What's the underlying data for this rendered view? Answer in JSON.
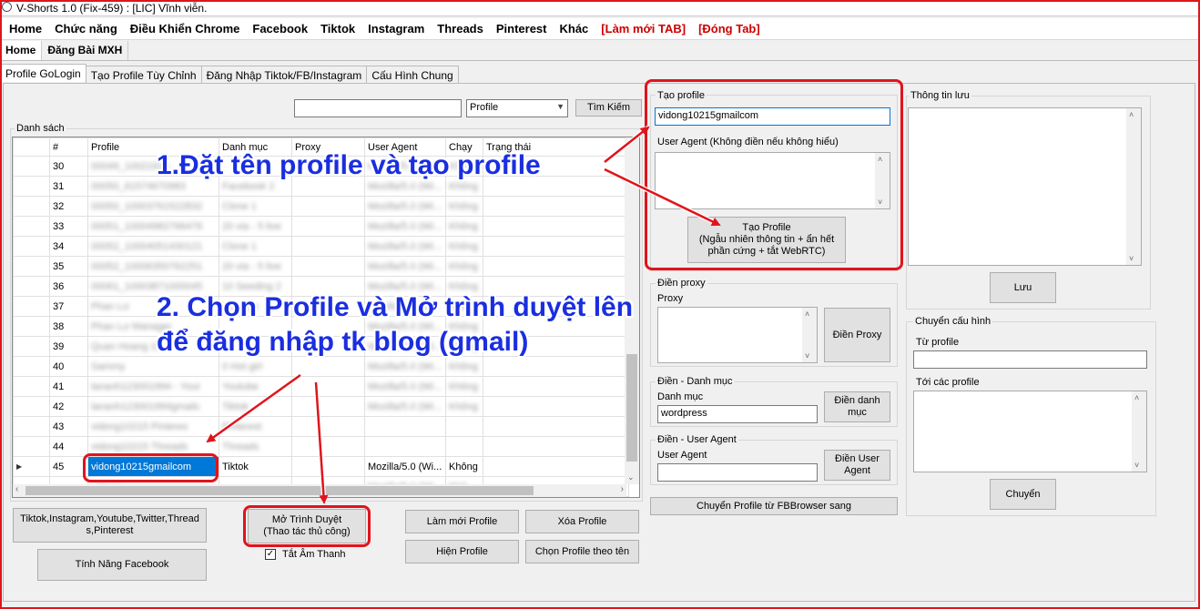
{
  "window": {
    "title": "V-Shorts 1.0 (Fix-459) : [LIC] Vĩnh viễn."
  },
  "menu": [
    {
      "label": "Home",
      "red": false
    },
    {
      "label": "Chức năng",
      "red": false
    },
    {
      "label": "Điều Khiển Chrome",
      "red": false
    },
    {
      "label": "Facebook",
      "red": false
    },
    {
      "label": "Tiktok",
      "red": false
    },
    {
      "label": "Instagram",
      "red": false
    },
    {
      "label": "Threads",
      "red": false
    },
    {
      "label": "Pinterest",
      "red": false
    },
    {
      "label": "Khác",
      "red": false
    },
    {
      "label": "[Làm mới TAB]",
      "red": true
    },
    {
      "label": "[Đóng Tab]",
      "red": true
    }
  ],
  "subtabs": [
    "Home",
    "Đăng Bài MXH"
  ],
  "tabs": [
    "Profile GoLogin",
    "Tạo Profile Tùy Chỉnh",
    "Đăng Nhập Tiktok/FB/Instagram",
    "Cấu Hình Chung"
  ],
  "search": {
    "value": "",
    "select": "Profile",
    "button": "Tìm Kiếm"
  },
  "list": {
    "label": "Danh sách",
    "columns": [
      "#",
      "Profile",
      "Danh mục",
      "Proxy",
      "User Agent",
      "Chạy",
      "Trạng thái"
    ],
    "rows": [
      {
        "n": "30",
        "profile": "00049_10021915",
        "cat": "",
        "ua": "Mozilla/5.0 (Wi...",
        "run": "Không"
      },
      {
        "n": "31",
        "profile": "00050_61574670983",
        "cat": "Facebook 2",
        "ua": "Mozilla/5.0 (Wi...",
        "run": "Không"
      },
      {
        "n": "32",
        "profile": "00050_10003761522832",
        "cat": "Clone 1",
        "ua": "Mozilla/5.0 (Wi...",
        "run": "Không"
      },
      {
        "n": "33",
        "profile": "00051_10004982766476",
        "cat": "20 via - 5 live",
        "ua": "Mozilla/5.0 (Wi...",
        "run": "Không"
      },
      {
        "n": "34",
        "profile": "00052_10004051430121",
        "cat": "Clone 1",
        "ua": "Mozilla/5.0 (Wi...",
        "run": "Không"
      },
      {
        "n": "35",
        "profile": "00052_10006350762251",
        "cat": "20 via - 5 live",
        "ua": "Mozilla/5.0 (Wi...",
        "run": "Không"
      },
      {
        "n": "36",
        "profile": "00061_10003871000045",
        "cat": "10 Seeding 2",
        "ua": "Mozilla/5.0 (Wi...",
        "run": "Không"
      },
      {
        "n": "37",
        "profile": "Phan Lư",
        "cat": "Youtube",
        "ua": "Mozilla/5.0 (Wi...",
        "run": "Không"
      },
      {
        "n": "38",
        "profile": "Phan Lư Manager",
        "cat": "",
        "ua": "Mozilla/5.0 (Wi...",
        "run": "Không"
      },
      {
        "n": "39",
        "profile": "Quan Hoang 10",
        "cat": "",
        "ua": "Mozilla/5.0 (Wi...",
        "run": "Không"
      },
      {
        "n": "40",
        "profile": "Sammy",
        "cat": "0 Hot girl",
        "ua": "Mozilla/5.0 (Wi...",
        "run": "Không"
      },
      {
        "n": "41",
        "profile": "lananh123001994 - Yout",
        "cat": "Youtube",
        "ua": "Mozilla/5.0 (Wi...",
        "run": "Không"
      },
      {
        "n": "42",
        "profile": "lananh123001994gmailc",
        "cat": "Tiktok",
        "ua": "Mozilla/5.0 (Wi...",
        "run": "Không"
      },
      {
        "n": "43",
        "profile": "vidong10215 Pinteres",
        "cat": "Pinterest",
        "ua": "",
        "run": ""
      },
      {
        "n": "44",
        "profile": "vidong10215 Threads",
        "cat": "Threads",
        "ua": "",
        "run": ""
      }
    ],
    "selected": {
      "n": "45",
      "profile": "vidong10215gmailcom",
      "cat": "Tiktok",
      "ua": "Mozilla/5.0 (Wi...",
      "run": "Không"
    },
    "partial": {
      "profile": "vidong...",
      "cat": "...",
      "ua": "Mozilla/5.0 (Wi...",
      "run": "Khô..."
    }
  },
  "buttons": {
    "tiktok": "Tiktok,Instagram,Youtube,Twitter,Threads,Pinterest",
    "facebook": "Tính Năng Facebook",
    "open_browser_1": "Mở Trình Duyệt",
    "open_browser_2": "(Thao tác thủ công)",
    "mute": "Tắt Âm Thanh",
    "refresh_profile": "Làm mới Profile",
    "delete_profile": "Xóa Profile",
    "show_profile": "Hiện Profile",
    "select_by_name": "Chọn Profile theo tên"
  },
  "create": {
    "group": "Tạo profile",
    "name_value": "vidong10215gmailcom",
    "ua_label": "User Agent (Không điền nếu không hiểu)",
    "btn1": "Tạo Profile",
    "btn2": "(Ngẫu nhiên thông tin + ẩn hết",
    "btn3": "phần cứng + tắt WebRTC)"
  },
  "proxy": {
    "group": "Điền proxy",
    "label": "Proxy",
    "button": "Điền Proxy"
  },
  "category": {
    "group": "Điền - Danh mục",
    "label": "Danh mục",
    "value": "wordpress",
    "button1": "Điền danh",
    "button2": "mục"
  },
  "useragent": {
    "group": "Điền - User Agent",
    "label": "User Agent",
    "button1": "Điền User",
    "button2": "Agent"
  },
  "fbbrowser": "Chuyển Profile từ FBBrowser sang",
  "saved": {
    "group": "Thông tin lưu",
    "button": "Lưu"
  },
  "transfer": {
    "group": "Chuyển cấu hình",
    "from": "Từ profile",
    "to": "Tới các profile",
    "button": "Chuyển"
  },
  "annotations": {
    "a1": "1.Đặt tên profile và tạo profile",
    "a2a": "2. Chọn Profile và Mở trình duyệt lên",
    "a2b": "để đăng nhập tk blog (gmail)"
  }
}
